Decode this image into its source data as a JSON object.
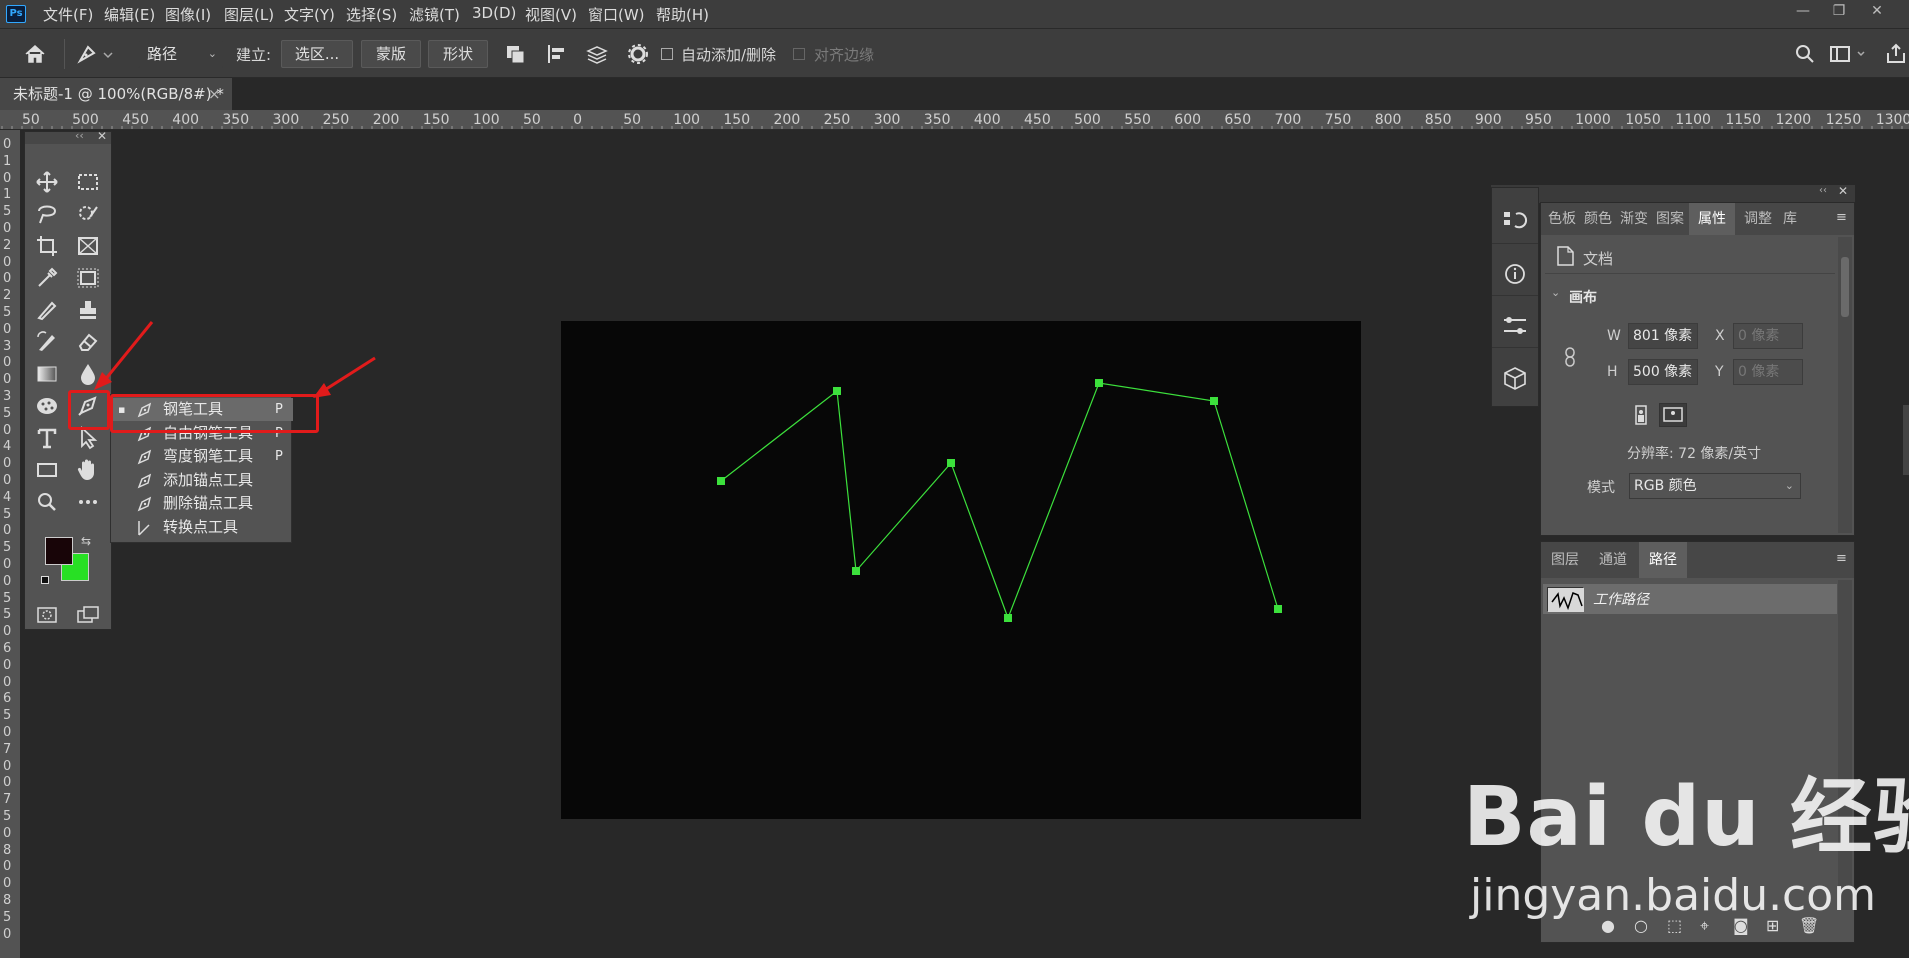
{
  "app": {
    "logo_text": "Ps"
  },
  "menubar": {
    "items": [
      "文件(F)",
      "编辑(E)",
      "图像(I)",
      "图层(L)",
      "文字(Y)",
      "选择(S)",
      "滤镜(T)",
      "3D(D)",
      "视图(V)",
      "窗口(W)",
      "帮助(H)"
    ],
    "window_controls": [
      "minimize",
      "restore",
      "close"
    ]
  },
  "options": {
    "mode_select": "路径",
    "build_label": "建立:",
    "selection_btn": "选区...",
    "mask_btn": "蒙版",
    "shape_btn": "形状",
    "auto_add_delete": "自动添加/删除",
    "auto_add_delete_checked": false,
    "align_edges": "对齐边缘",
    "align_edges_checked": false
  },
  "document_tab": {
    "title": "未标题-1 @ 100%(RGB/8#) *",
    "close": "×"
  },
  "ruler": {
    "top_labels": [
      "50",
      "500",
      "450",
      "400",
      "350",
      "300",
      "250",
      "200",
      "150",
      "100",
      "50",
      "0",
      "50",
      "100",
      "150",
      "200",
      "250",
      "300",
      "350",
      "400",
      "450",
      "500",
      "550",
      "600",
      "650",
      "700",
      "750",
      "800",
      "850",
      "900",
      "950",
      "1000",
      "1050",
      "1100",
      "1150",
      "1200",
      "1250",
      "1300"
    ],
    "left_labels": [
      "0",
      "1",
      "0",
      "1",
      "5",
      "0",
      "2",
      "0",
      "0",
      "2",
      "5",
      "0",
      "3",
      "0",
      "0",
      "3",
      "5",
      "0",
      "4",
      "0",
      "0",
      "4",
      "5",
      "0",
      "5",
      "0",
      "0",
      "5",
      "5",
      "0",
      "6",
      "0",
      "0",
      "6",
      "5",
      "0",
      "7",
      "0",
      "0",
      "7",
      "5",
      "0",
      "8",
      "0",
      "0",
      "8",
      "5",
      "0"
    ]
  },
  "toolbox": {
    "foreground_color": "#180508",
    "background_color": "#28e024"
  },
  "flyout": {
    "items": [
      {
        "label": "钢笔工具",
        "key": "P",
        "selected": true
      },
      {
        "label": "自由钢笔工具",
        "key": "P",
        "selected": false
      },
      {
        "label": "弯度钢笔工具",
        "key": "P",
        "selected": false
      },
      {
        "label": "添加锚点工具",
        "key": "",
        "selected": false
      },
      {
        "label": "删除锚点工具",
        "key": "",
        "selected": false
      },
      {
        "label": "转换点工具",
        "key": "",
        "selected": false
      }
    ]
  },
  "canvas": {
    "background": "#070707",
    "path_color": "#3ce03c",
    "path_points": [
      [
        160,
        160
      ],
      [
        276,
        70
      ],
      [
        295,
        250
      ],
      [
        390,
        142
      ],
      [
        447,
        297
      ],
      [
        538,
        62
      ],
      [
        653,
        80
      ],
      [
        717,
        288
      ]
    ]
  },
  "properties_panel": {
    "tabs": [
      "色板",
      "颜色",
      "渐变",
      "图案",
      "属性",
      "调整",
      "库"
    ],
    "active_tab": "属性",
    "section_doc": "文档",
    "section_canvas": "画布",
    "w_label": "W",
    "w_value": "801 像素",
    "h_label": "H",
    "h_value": "500 像素",
    "x_label": "X",
    "x_value": "0 像素",
    "y_label": "Y",
    "y_value": "0 像素",
    "resolution": "分辨率: 72 像素/英寸",
    "mode_label": "模式",
    "mode_value": "RGB 颜色"
  },
  "paths_panel": {
    "tabs": [
      "图层",
      "通道",
      "路径"
    ],
    "active_tab": "路径",
    "paths": [
      "工作路径"
    ]
  },
  "watermark": {
    "logo": "Bai du 经验",
    "url": "jingyan.baidu.com"
  }
}
